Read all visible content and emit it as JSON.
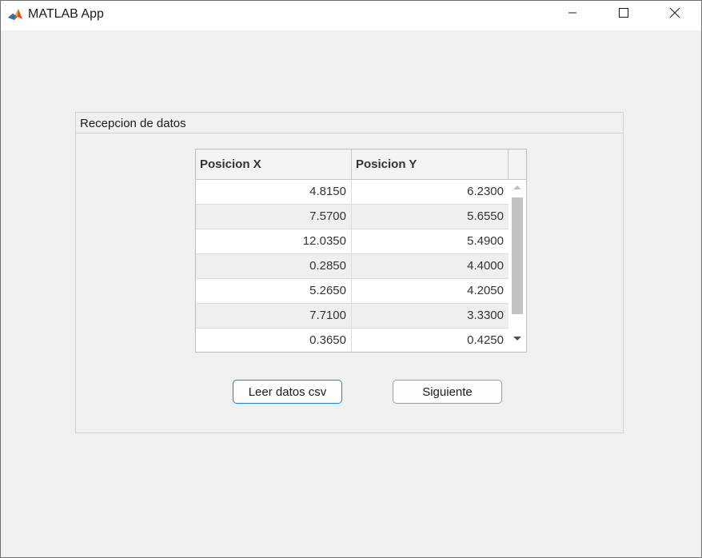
{
  "window": {
    "title": "MATLAB App",
    "icon": "matlab-icon",
    "controls": {
      "minimize_icon": "minimize-icon",
      "maximize_icon": "maximize-icon",
      "close_icon": "close-icon"
    }
  },
  "panel": {
    "title": "Recepcion de datos"
  },
  "table": {
    "columns": [
      "Posicion X",
      "Posicion Y"
    ],
    "rows": [
      [
        "4.8150",
        "6.2300"
      ],
      [
        "7.5700",
        "5.6550"
      ],
      [
        "12.0350",
        "5.4900"
      ],
      [
        "0.2850",
        "4.4000"
      ],
      [
        "5.2650",
        "4.2050"
      ],
      [
        "7.7100",
        "3.3300"
      ],
      [
        "0.3650",
        "0.4250"
      ]
    ]
  },
  "buttons": {
    "read_csv": "Leer datos csv",
    "next": "Siguiente"
  },
  "colors": {
    "window_bg": "#f0f0f0",
    "focus_border": "#1f84d6"
  }
}
